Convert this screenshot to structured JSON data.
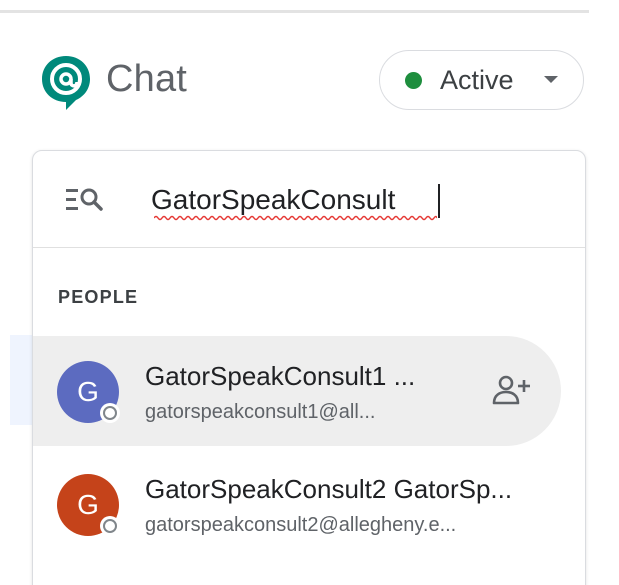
{
  "header": {
    "app_title": "Chat",
    "status_label": "Active"
  },
  "search": {
    "value": "GatorSpeakConsult"
  },
  "results": {
    "section_label": "PEOPLE",
    "people": [
      {
        "initial": "G",
        "name": "GatorSpeakConsult1 ...",
        "email": "gatorspeakconsult1@all...",
        "avatar_color": "#5c6bc0"
      },
      {
        "initial": "G",
        "name": "GatorSpeakConsult2 GatorSp...",
        "email": "gatorspeakconsult2@allegheny.e...",
        "avatar_color": "#c5431a"
      }
    ]
  },
  "icons": {
    "logo": "google-chat-logo",
    "search": "search-list-icon",
    "add_person": "person-add-icon",
    "dropdown": "caret-down-icon"
  },
  "colors": {
    "active_status": "#1e8e3e",
    "logo_green": "#00897b",
    "hover_row": "#eeeeee"
  }
}
